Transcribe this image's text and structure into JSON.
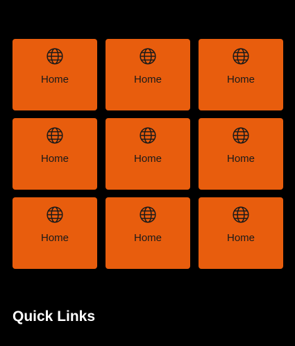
{
  "tiles": [
    {
      "label": "Home",
      "icon": "globe-icon"
    },
    {
      "label": "Home",
      "icon": "globe-icon"
    },
    {
      "label": "Home",
      "icon": "globe-icon"
    },
    {
      "label": "Home",
      "icon": "globe-icon"
    },
    {
      "label": "Home",
      "icon": "globe-icon"
    },
    {
      "label": "Home",
      "icon": "globe-icon"
    },
    {
      "label": "Home",
      "icon": "globe-icon"
    },
    {
      "label": "Home",
      "icon": "globe-icon"
    },
    {
      "label": "Home",
      "icon": "globe-icon"
    }
  ],
  "section": {
    "title": "Quick Links"
  },
  "colors": {
    "background": "#000000",
    "tile": "#e85d0d",
    "tile_text": "#1a1a1a",
    "title_text": "#ffffff"
  }
}
